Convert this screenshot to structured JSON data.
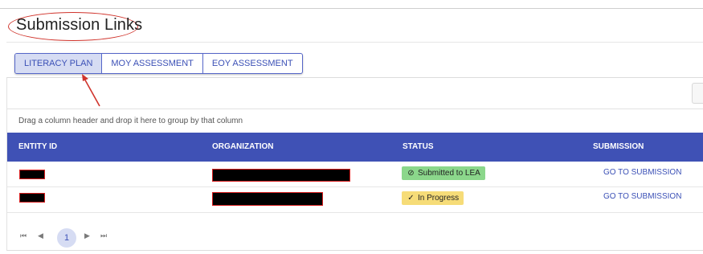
{
  "page": {
    "title": "Submission Links"
  },
  "tabs": [
    {
      "label": "LITERACY PLAN",
      "active": true
    },
    {
      "label": "MOY ASSESSMENT",
      "active": false
    },
    {
      "label": "EOY ASSESSMENT",
      "active": false
    }
  ],
  "grid": {
    "group_hint": "Drag a column header and drop it here to group by that column",
    "columns": [
      "ENTITY ID",
      "ORGANIZATION",
      "STATUS",
      "SUBMISSION"
    ],
    "rows": [
      {
        "entity_id": "",
        "organization": "",
        "status": "Submitted to LEA",
        "status_icon": "check-circle-icon",
        "status_color": "#8bd78b",
        "submission": "GO TO SUBMISSION"
      },
      {
        "entity_id": "",
        "organization": "",
        "status": "In Progress",
        "status_icon": "check-icon",
        "status_color": "#f6dc78",
        "submission": "GO TO SUBMISSION"
      }
    ]
  },
  "pager": {
    "current_page": "1",
    "first_icon": "first-page-icon",
    "prev_icon": "prev-page-icon",
    "next_icon": "next-page-icon",
    "last_icon": "last-page-icon"
  },
  "colors": {
    "header_bg": "#3f51b5",
    "accent": "#3b50b6",
    "annotation": "#d0342c"
  }
}
